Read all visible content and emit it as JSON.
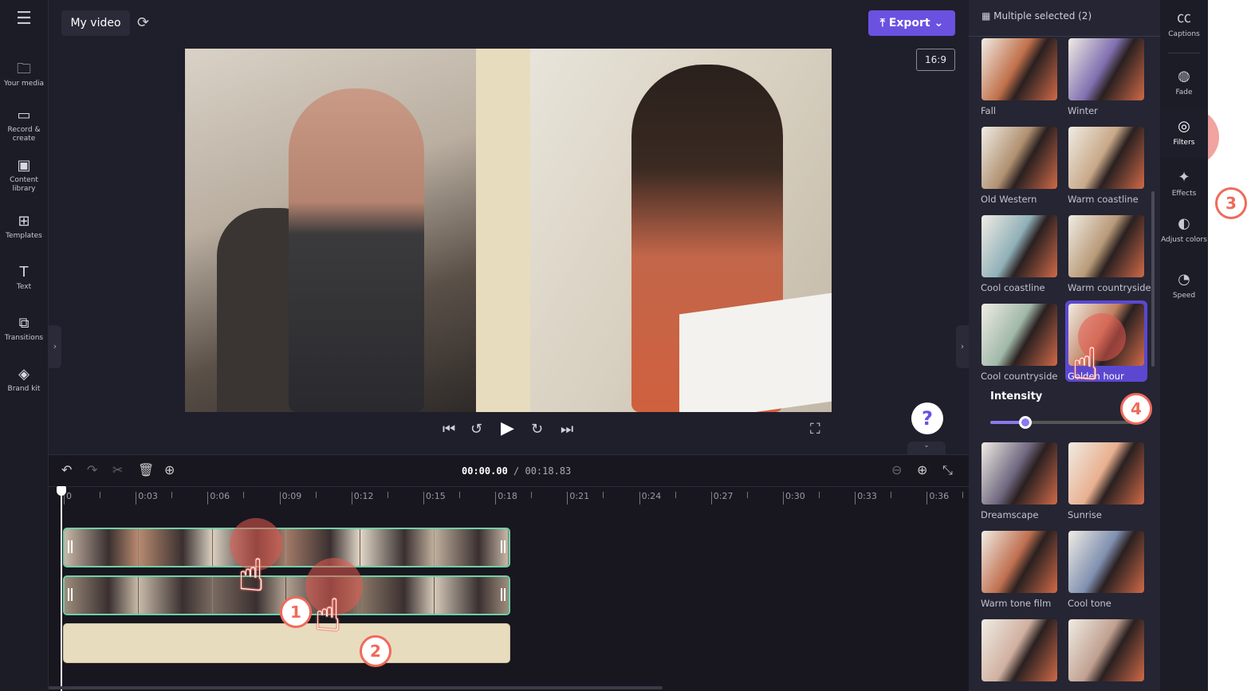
{
  "sidebar": {
    "items": [
      {
        "label": "Your media",
        "icon": "folder-icon"
      },
      {
        "label": "Record & create",
        "icon": "camera-icon"
      },
      {
        "label": "Content library",
        "icon": "library-icon"
      },
      {
        "label": "Templates",
        "icon": "templates-icon"
      },
      {
        "label": "Text",
        "icon": "text-icon"
      },
      {
        "label": "Transitions",
        "icon": "transitions-icon"
      },
      {
        "label": "Brand kit",
        "icon": "brand-kit-icon"
      }
    ]
  },
  "header": {
    "title": "My video",
    "export_label": "Export",
    "aspect_ratio": "16:9"
  },
  "playback": {
    "current_time": "00:00.00",
    "total_time": "/ 00:18.83"
  },
  "ruler": [
    "0",
    "0:03",
    "0:06",
    "0:09",
    "0:12",
    "0:15",
    "0:18",
    "0:21",
    "0:24",
    "0:27",
    "0:30",
    "0:33",
    "0:36"
  ],
  "panel": {
    "header": "Multiple selected (2)",
    "intensity_label": "Intensity",
    "intensity_value": 0.25,
    "filters": [
      "Fall",
      "Winter",
      "Old Western",
      "Warm coastline",
      "Cool coastline",
      "Warm countryside",
      "Cool countryside",
      "Golden hour",
      "Dreamscape",
      "Sunrise",
      "Warm tone film",
      "Cool tone",
      "",
      ""
    ],
    "selected_filter": "Golden hour"
  },
  "iconbar": [
    {
      "label": "Captions",
      "icon": "captions-icon"
    },
    {
      "label": "Fade",
      "icon": "fade-icon"
    },
    {
      "label": "Filters",
      "icon": "filters-icon"
    },
    {
      "label": "Effects",
      "icon": "effects-icon"
    },
    {
      "label": "Adjust colors",
      "icon": "adjust-colors-icon"
    },
    {
      "label": "Speed",
      "icon": "speed-icon"
    }
  ],
  "steps": [
    "1",
    "2",
    "3",
    "4"
  ],
  "help": "?",
  "colors": {
    "accent": "#6b51e0",
    "clip_border": "#6fd0a8",
    "tap": "#f06a5a"
  }
}
